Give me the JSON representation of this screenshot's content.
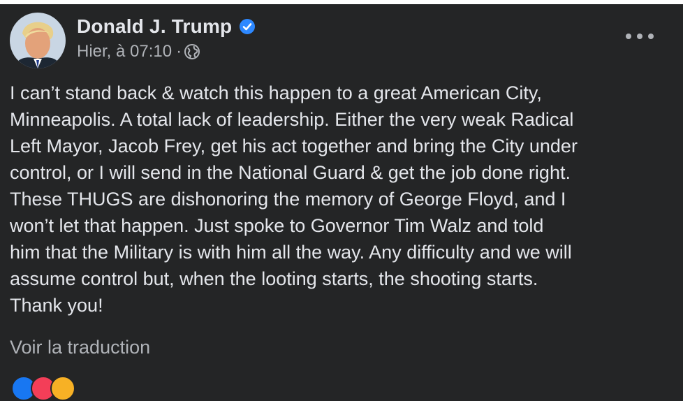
{
  "post": {
    "author": "Donald J. Trump",
    "verified_icon": "verified-badge-icon",
    "timestamp": "Hier, à 07:10",
    "separator": "·",
    "audience_icon": "globe-icon",
    "more_icon": "more-options-icon",
    "text": "I can’t stand back & watch this happen to a great American City,\nMinneapolis. A total lack of leadership. Either the very weak Radical\nLeft Mayor, Jacob Frey, get his act together and bring the City under\ncontrol, or I will send in the National Guard & get the job done right.\nThese THUGS are dishonoring the memory of George Floyd, and I\nwon’t let that happen. Just spoke to Governor Tim Walz and told\nhim that the Military is with him all the way. Any difficulty and we will\nassume control but, when the looting starts, the shooting starts.\nThank you!",
    "translate_link": "Voir la traduction"
  },
  "reactions": [
    "like",
    "love",
    "haha"
  ],
  "colors": {
    "background": "#242526",
    "primary_text": "#e4e6eb",
    "secondary_text": "#b0b3b8",
    "verified_blue": "#2d88ff"
  }
}
